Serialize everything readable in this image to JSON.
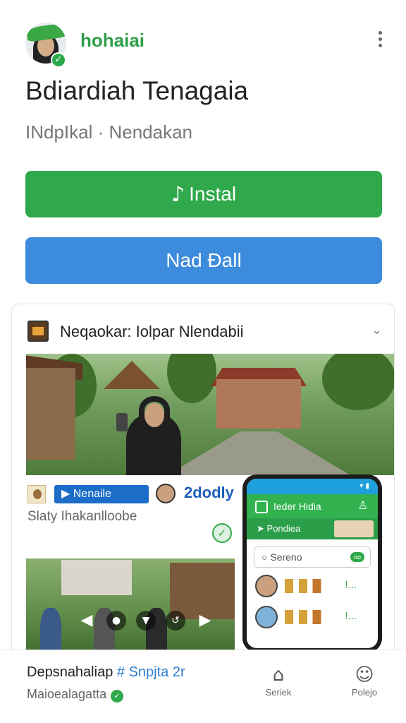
{
  "header": {
    "brand": "hohaiai",
    "title": "Bdiardiah Tenagaia",
    "subtitle": "INdpIkal · Nendakan"
  },
  "buttons": {
    "install_label": "Instal",
    "install_icon": "note-icon",
    "read_label": "Nad Ðall"
  },
  "card": {
    "title": "Neqaokar: Iolpar Nlendabii",
    "tag": "Nenaile",
    "handle": "2dodly",
    "description": "Slaty Ihakanlloobe"
  },
  "phone": {
    "app_title": "Ieder Hidia",
    "menu_label": "Pondiea",
    "search_placeholder": "Sereno",
    "search_badge": "oo",
    "row_action": "!..."
  },
  "bottom": {
    "title": "Depsnahaliap",
    "title_tag": "# Snpjta 2r",
    "subtitle": "Maioealagatta",
    "nav": [
      {
        "icon": "home-icon",
        "label": "Seriek"
      },
      {
        "icon": "profile-icon",
        "label": "Polejo"
      }
    ]
  },
  "colors": {
    "brand_green": "#2e9e4a",
    "install_green": "#2fa94b",
    "read_blue": "#3c8bdc",
    "tag_blue": "#1c6dc8"
  }
}
